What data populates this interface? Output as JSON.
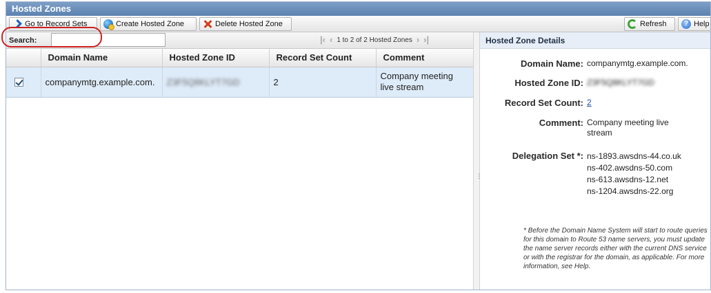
{
  "window": {
    "title": "Hosted Zones"
  },
  "toolbar": {
    "go_to_record_sets": "Go to Record Sets",
    "create_hosted_zone": "Create Hosted Zone",
    "delete_hosted_zone": "Delete Hosted Zone",
    "refresh": "Refresh",
    "help": "Help"
  },
  "search": {
    "label": "Search:",
    "value": ""
  },
  "pager": {
    "text": "1 to 2 of 2 Hosted Zones"
  },
  "table": {
    "columns": [
      "Domain Name",
      "Hosted Zone ID",
      "Record Set Count",
      "Comment"
    ],
    "rows": [
      {
        "checked": true,
        "domain": "companymtg.example.com.",
        "zone_id": "Z3F5Q8KLYT7GD",
        "record_count": "2",
        "comment": "Company meeting live stream"
      }
    ]
  },
  "details": {
    "heading": "Hosted Zone Details",
    "domain_label": "Domain Name:",
    "domain_value": "companymtg.example.com.",
    "zone_id_label": "Hosted Zone ID:",
    "zone_id_value": "Z3F5Q8KLYT7GD",
    "record_count_label": "Record Set Count:",
    "record_count_value": "2",
    "comment_label": "Comment:",
    "comment_value": "Company meeting live stream",
    "delegation_label": "Delegation Set *:",
    "delegation_set": [
      "ns-1893.awsdns-44.co.uk",
      "ns-402.awsdns-50.com",
      "ns-613.awsdns-12.net",
      "ns-1204.awsdns-22.org"
    ],
    "footnote": "* Before the Domain Name System will start to route queries for this domain to Route 53 name servers, you must update the name server records either with the current DNS service or with the registrar for the domain, as applicable. For more information, see Help."
  },
  "colors": {
    "title_bar": "#5d82b0",
    "selected_row": "#deebf8",
    "highlight_ring": "#cc2020"
  }
}
